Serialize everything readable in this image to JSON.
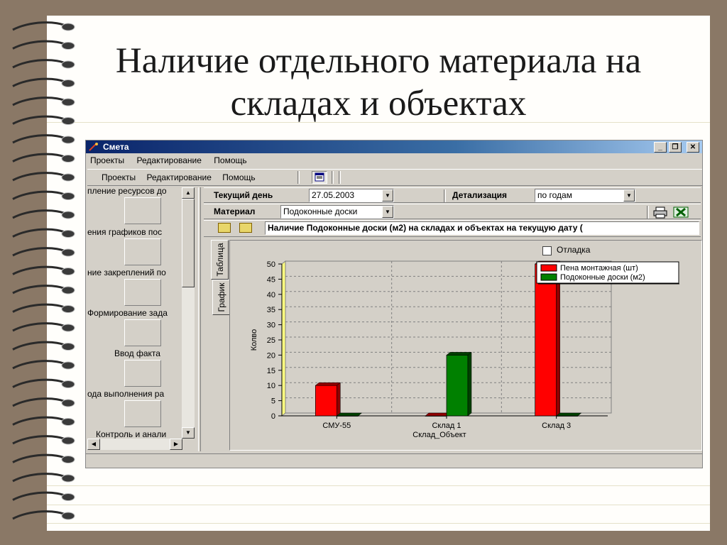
{
  "slide": {
    "title_line1": "Наличие отдельного материала на",
    "title_line2": "складах и объектах"
  },
  "window": {
    "title": "Смета",
    "menu": [
      "Проекты",
      "Редактирование",
      "Помощь"
    ],
    "toolbar_menu": [
      "Проекты",
      "Редактирование",
      "Помощь"
    ]
  },
  "tasks": [
    "пление ресурсов до",
    "ения графиков пос",
    "ние закреплений по",
    "Формирование зада",
    "Ввод факта",
    "ода выполнения ра",
    "Контроль и анали"
  ],
  "filters": {
    "day_label": "Текущий день",
    "day_value": "27.05.2003",
    "detail_label": "Детализация",
    "detail_value": "по годам",
    "material_label": "Материал",
    "material_value": "Подоконные доски",
    "info_text": "Наличие Подоконные доски (м2) на складах и объектах на текущую дату ("
  },
  "tabs": [
    "Таблица",
    "График"
  ],
  "debug_checkbox": {
    "label": "Отладка",
    "checked": false
  },
  "chart_data": {
    "type": "bar",
    "categories": [
      "СМУ-55",
      "Склад 1",
      "Склад 3"
    ],
    "series": [
      {
        "name": "Пена монтажная (шт)",
        "color": "#ff0000",
        "values": [
          10,
          0,
          50
        ]
      },
      {
        "name": "Подоконные доски (м2)",
        "color": "#008000",
        "values": [
          0,
          20,
          0
        ]
      }
    ],
    "xlabel": "Склад_Объект",
    "ylabel": "Колво",
    "ylim": [
      0,
      50
    ],
    "yticks": [
      0,
      5,
      10,
      15,
      20,
      25,
      30,
      35,
      40,
      45,
      50
    ],
    "grid": true,
    "legend": "top-right"
  },
  "colors": {
    "background": "#8a7866",
    "window_face": "#d4d0c8",
    "titlebar": "#0a246a"
  }
}
